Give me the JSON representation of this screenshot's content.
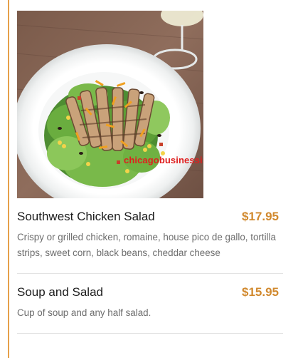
{
  "colors": {
    "accent": "#e6a04a",
    "price": "#d1892e",
    "watermark": "#e01e1e"
  },
  "image": {
    "watermark_text": "chicagobusinessinfo.com"
  },
  "menu": {
    "items": [
      {
        "name": "Southwest Chicken Salad",
        "price": "$17.95",
        "description": "Crispy or grilled chicken, romaine, house pico de gallo, tortilla strips, sweet corn, black beans, cheddar cheese"
      },
      {
        "name": "Soup and Salad",
        "price": "$15.95",
        "description": "Cup of soup and any half salad."
      }
    ]
  }
}
